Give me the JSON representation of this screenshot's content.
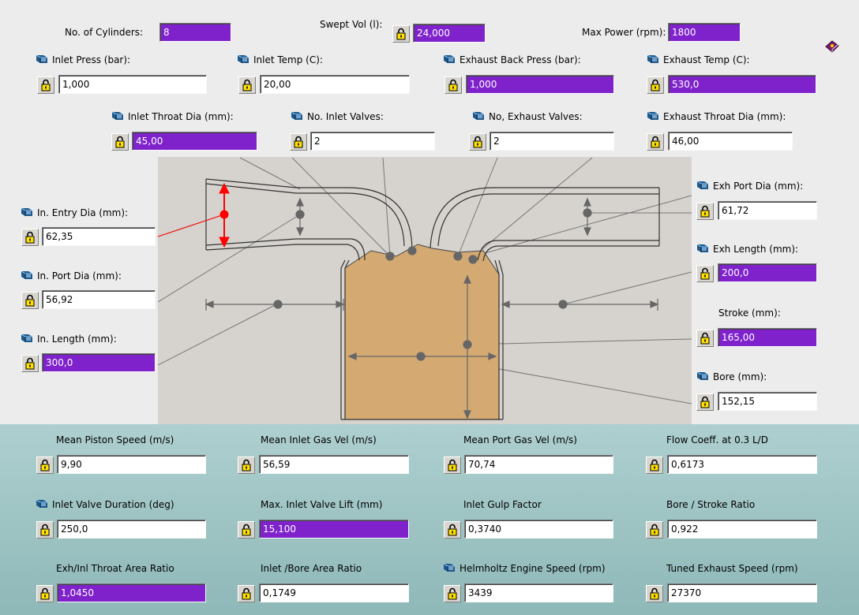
{
  "colors": {
    "input_highlight": "#7f22cc",
    "bottom_panel": "#9cc4c4",
    "diagram_bg": "#d6d3ce",
    "chamber": "#d4aa72",
    "marker": "#ff0000"
  },
  "icons": {
    "info": "book-icon",
    "lock": "padlock-icon",
    "help": "help-book-icon"
  },
  "top": {
    "cylinders": {
      "label": "No. of Cylinders:",
      "value": "8"
    },
    "swept": {
      "label": "Swept Vol (l):",
      "value": "24,000"
    },
    "maxpower": {
      "label": "Max Power (rpm):",
      "value": "1800"
    }
  },
  "params": {
    "inlet_press": {
      "label": "Inlet Press (bar):",
      "value": "1,000"
    },
    "inlet_temp": {
      "label": "Inlet Temp (C):",
      "value": "20,00"
    },
    "exh_back_press": {
      "label": "Exhaust Back Press (bar):",
      "value": "1,000"
    },
    "exh_temp": {
      "label": "Exhaust Temp (C):",
      "value": "530,0"
    },
    "inlet_throat": {
      "label": "Inlet Throat Dia (mm):",
      "value": "45,00"
    },
    "no_inlet_valves": {
      "label": "No. Inlet Valves:",
      "value": "2"
    },
    "no_exh_valves": {
      "label": "No, Exhaust Valves:",
      "value": "2"
    },
    "exh_throat": {
      "label": "Exhaust Throat Dia (mm):",
      "value": "46,00"
    },
    "in_entry": {
      "label": "In. Entry Dia (mm):",
      "value": "62,35"
    },
    "in_port": {
      "label": "In. Port Dia (mm):",
      "value": "56,92"
    },
    "in_length": {
      "label": "In. Length (mm):",
      "value": "300,0"
    },
    "exh_port": {
      "label": "Exh Port Dia (mm):",
      "value": "61,72"
    },
    "exh_length": {
      "label": "Exh Length (mm):",
      "value": "200,0"
    },
    "stroke": {
      "label": "Stroke (mm):",
      "value": "165,00"
    },
    "bore": {
      "label": "Bore (mm):",
      "value": "152,15"
    }
  },
  "results": {
    "piston_speed": {
      "label": "Mean Piston Speed (m/s)",
      "value": "9,90"
    },
    "inlet_gas_vel": {
      "label": "Mean Inlet Gas Vel (m/s)",
      "value": "56,59"
    },
    "port_gas_vel": {
      "label": "Mean Port Gas Vel (m/s)",
      "value": "70,74"
    },
    "flow_coeff": {
      "label": "Flow Coeff. at 0.3 L/D",
      "value": "0,6173"
    },
    "valve_duration": {
      "label": "Inlet Valve Duration (deg)",
      "value": "250,0"
    },
    "valve_lift": {
      "label": "Max. Inlet Valve Lift (mm)",
      "value": "15,100"
    },
    "gulp": {
      "label": "Inlet Gulp Factor",
      "value": "0,3740"
    },
    "bore_stroke": {
      "label": "Bore / Stroke Ratio",
      "value": "0,922"
    },
    "throat_ratio": {
      "label": "Exh/Inl Throat Area Ratio",
      "value": "1,0450"
    },
    "bore_area": {
      "label": "Inlet /Bore Area Ratio",
      "value": "0,1749"
    },
    "helmholtz": {
      "label": "Helmholtz Engine Speed (rpm)",
      "value": "3439"
    },
    "tuned_exh": {
      "label": "Tuned Exhaust Speed (rpm)",
      "value": "27370"
    }
  }
}
